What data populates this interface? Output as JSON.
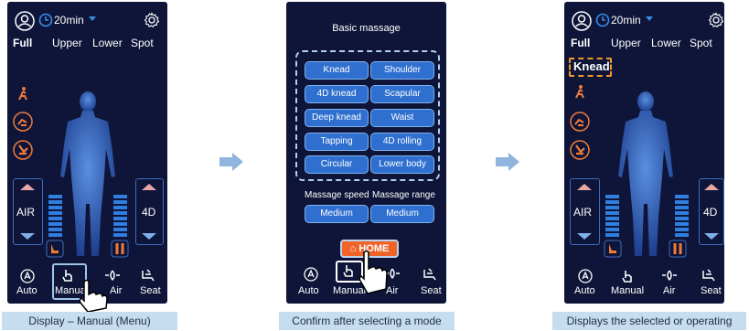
{
  "arrows_color": "#8fb5dd",
  "panel1": {
    "time": "20min",
    "tabs": [
      "Full",
      "Upper",
      "Lower",
      "Spot"
    ],
    "air_label": "AIR",
    "fourd_label": "4D",
    "bottom": [
      "Auto",
      "Manual",
      "Air",
      "Seat"
    ],
    "caption": "Display – Manual (Menu)"
  },
  "panel2": {
    "title": "Basic massage",
    "modes": [
      "Knead",
      "Shoulder",
      "4D knead",
      "Scapular",
      "Deep knead",
      "Waist",
      "Tapping",
      "4D rolling",
      "Circular",
      "Lower body"
    ],
    "speed_label": "Massage speed",
    "range_label": "Massage range",
    "speed_value": "Medium",
    "range_value": "Medium",
    "home_label": "HOME",
    "bottom": [
      "Auto",
      "Manual",
      "Air",
      "Seat"
    ],
    "caption": "Confirm after selecting a mode"
  },
  "panel3": {
    "time": "20min",
    "tabs": [
      "Full",
      "Upper",
      "Lower",
      "Spot"
    ],
    "selected_mode": "Knead",
    "air_label": "AIR",
    "fourd_label": "4D",
    "bottom": [
      "Auto",
      "Manual",
      "Air",
      "Seat"
    ],
    "caption": "Displays the selected or operating mode"
  },
  "colors": {
    "panel_bg": "#0e1538",
    "accent_blue": "#2f7fe0",
    "highlight_orange": "#f29a28",
    "home_orange": "#f0642a",
    "caption_bg": "#c6dcef"
  }
}
